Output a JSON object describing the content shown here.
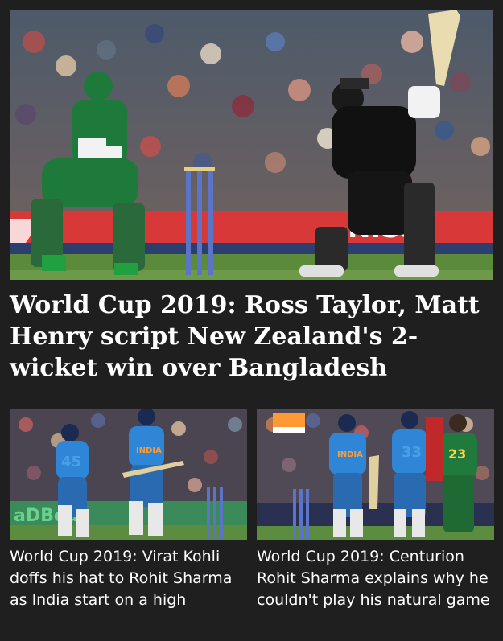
{
  "hero": {
    "headline": "World Cup 2019: Ross Taylor, Matt Henry script New Zealand's 2-wicket win over Bangladesh",
    "image_alt": "Ross Taylor batting as Bangladesh wicketkeeper crouches behind the stumps",
    "banner_text": "NISS"
  },
  "cards": [
    {
      "headline": "World Cup 2019: Virat Kohli doffs his hat to Rohit Sharma as India start on a high",
      "image_alt": "Two India batsmen running between the wickets",
      "jersey_left": "45",
      "jersey_right": "INDIA",
      "board_text": "aDBody"
    },
    {
      "headline": "World Cup 2019: Centurion Rohit Sharma explains why he couldn't play his natural game",
      "image_alt": "Rohit Sharma with teammate and South Africa player on the field",
      "jersey_left": "INDIA",
      "jersey_mid": "33",
      "jersey_right": "23"
    }
  ],
  "colors": {
    "background": "#1f1f1f",
    "text": "#ffffff",
    "nz_kit": "#111111",
    "bangladesh_kit": "#1e7a3a",
    "india_kit": "#2f86d6",
    "sa_kit": "#1f7a3c",
    "outfield": "#5a8a3a"
  }
}
